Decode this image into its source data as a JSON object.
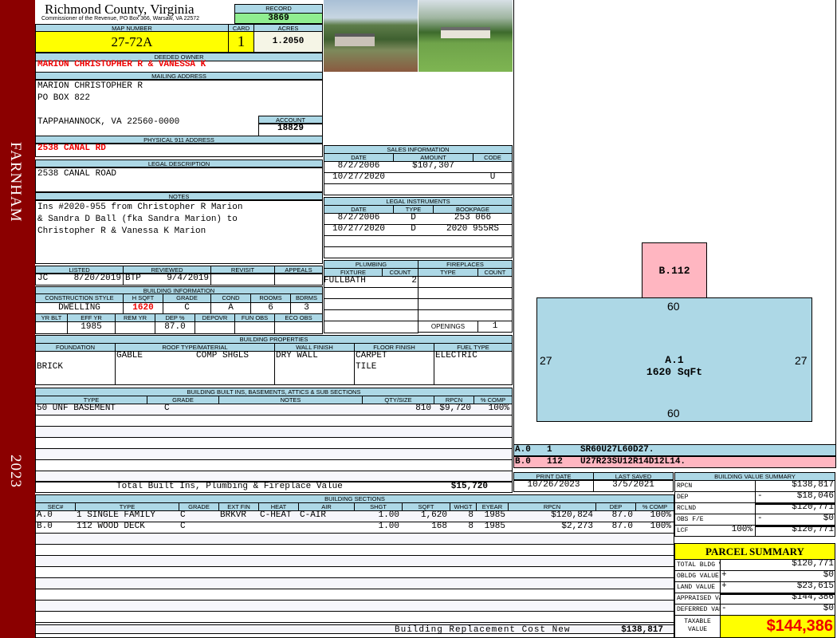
{
  "district": "FARNHAM",
  "year": "2023",
  "header": {
    "county": "Richmond County, Virginia",
    "subtitle": "Commissioner of the Revenue, PO Box 366, Warsaw, VA 22572",
    "record_label": "RECORD",
    "record": "3869"
  },
  "parcel": {
    "map_label": "MAP NUMBER",
    "map": "27-72A",
    "card_label": "CARD",
    "card": "1",
    "acres_label": "ACRES",
    "acres": "1.2050"
  },
  "owner": {
    "label": "DEEDED OWNER",
    "value": "MARION CHRISTOPHER R & VANESSA K"
  },
  "mailing": {
    "label": "MAILING ADDRESS",
    "line1": "MARION CHRISTOPHER R",
    "line2": "PO BOX 822",
    "line3": "TAPPAHANNOCK, VA 22560-0000",
    "account_label": "ACCOUNT",
    "account": "18829"
  },
  "physical": {
    "label": "PHYSICAL 911 ADDRESS",
    "value": "2538 CANAL RD"
  },
  "legal": {
    "label": "LEGAL DESCRIPTION",
    "value": "2538 CANAL ROAD"
  },
  "notes": {
    "label": "NOTES",
    "lines": [
      "Ins #2020-955 from Christopher R Marion",
      "& Sandra D Ball (fka Sandra Marion) to",
      "Christopher R & Vanessa K Marion"
    ]
  },
  "review": {
    "headers": [
      "LISTED",
      "REVIEWED",
      "REVISIT",
      "APPEALS"
    ],
    "listed_by": "JC",
    "listed": "8/20/2019",
    "reviewed_by": "BTP",
    "reviewed": "9/4/2019"
  },
  "building_info": {
    "label": "BUILDING INFORMATION",
    "headers1": [
      "CONSTRUCTION STYLE",
      "H SQFT",
      "GRADE",
      "COND",
      "ROOMS",
      "BDRMS"
    ],
    "values1": [
      "DWELLING",
      "1620",
      "C",
      "A",
      "6",
      "3"
    ],
    "headers2": [
      "YR BLT",
      "EFF YR",
      "REM YR",
      "DEP %",
      "DEPOVR",
      "FUN OBS",
      "ECO OBS"
    ],
    "values2": [
      "",
      "1985",
      "",
      "87.0",
      "",
      "",
      ""
    ]
  },
  "sales": {
    "label": "SALES INFORMATION",
    "headers": [
      "DATE",
      "AMOUNT",
      "CODE"
    ],
    "rows": [
      [
        "8/2/2006",
        "$107,307",
        ""
      ],
      [
        "10/27/2020",
        "",
        "U"
      ],
      [
        "",
        "",
        ""
      ]
    ]
  },
  "instruments": {
    "label": "LEGAL INSTRUMENTS",
    "headers": [
      "DATE",
      "TYPE",
      "BOOKPAGE"
    ],
    "rows": [
      [
        "8/2/2006",
        "D",
        "253 066"
      ],
      [
        "10/27/2020",
        "D",
        "2020 955RS"
      ],
      [
        "",
        "",
        ""
      ],
      [
        "",
        "",
        ""
      ]
    ]
  },
  "plumbing": {
    "label": "PLUMBING",
    "headers": [
      "FIXTURE",
      "COUNT"
    ],
    "rows": [
      [
        "FULLBATH",
        "2"
      ]
    ]
  },
  "fireplaces": {
    "label": "FIREPLACES",
    "headers": [
      "TYPE",
      "COUNT"
    ],
    "openings_label": "OPENINGS",
    "openings": "1"
  },
  "properties": {
    "label": "BUILDING PROPERTIES",
    "headers": [
      "FOUNDATION",
      "ROOF TYPE/MATERIAL",
      "WALL FINISH",
      "FLOOR FINISH",
      "FUEL TYPE"
    ],
    "foundation": "BRICK",
    "roof_type": "GABLE",
    "roof_material": "COMP SHGLS",
    "wall": "DRY WALL",
    "floor1": "CARPET",
    "floor2": "TILE",
    "fuel": "ELECTRIC"
  },
  "builtins": {
    "label": "BUILDING BUILT INS, BASEMENTS, ATTICS & SUB SECTIONS",
    "headers": [
      "TYPE",
      "GRADE",
      "NOTES",
      "QTY/SIZE",
      "RPCN",
      "% COMP"
    ],
    "rows": [
      [
        "50 UNF BASEMENT",
        "C",
        "",
        "810",
        "$9,720",
        "100%"
      ]
    ],
    "total_label": "Total Built Ins, Plumbing & Fireplace Value",
    "total": "$15,720"
  },
  "sections": {
    "label": "BUILDING SECTIONS",
    "headers": [
      "SEC#",
      "TYPE",
      "GRADE",
      "EXT FIN",
      "HEAT",
      "AIR",
      "SHGT",
      "SQFT",
      "WHGT",
      "EYEAR",
      "RPCN",
      "DEP",
      "% COMP"
    ],
    "rows": [
      [
        "A.0",
        "1 SINGLE FAMILY",
        "C",
        "BRKVR",
        "C-HEAT",
        "C-AIR",
        "1.00",
        "1,620",
        "8",
        "1985",
        "$120,824",
        "87.0",
        "100%"
      ],
      [
        "B.0",
        "112 WOOD DECK",
        "C",
        "",
        "",
        "",
        "1.00",
        "168",
        "8",
        "1985",
        "$2,273",
        "87.0",
        "100%"
      ]
    ],
    "total_label": "Building Replacement Cost New",
    "total": "$138,817"
  },
  "sketch": {
    "a_label": "A.1",
    "a_area": "1620 SqFt",
    "b_label": "B.112",
    "top": "60",
    "bottom": "60",
    "left": "27",
    "right": "27",
    "legend": [
      [
        "A.0",
        "1",
        "SR60U27L60D27."
      ],
      [
        "B.0",
        "112",
        "U27R23SU12R14D12L14."
      ]
    ],
    "a_color": "#add8e6",
    "b_color": "#ffb6c1"
  },
  "dates": {
    "print_label": "PRINT DATE",
    "print": "10/26/2023",
    "saved_label": "LAST SAVED",
    "saved": "3/5/2021"
  },
  "value_summary": {
    "label": "BUILDING VALUE SUMMARY",
    "rows": [
      [
        "RPCN",
        "",
        "",
        "$138,817"
      ],
      [
        "DEP",
        "",
        "-",
        "$18,046"
      ],
      [
        "RCLND",
        "",
        "",
        "$120,771"
      ],
      [
        "OBS F/E",
        "",
        "-",
        "$0"
      ],
      [
        "LCF",
        "100%",
        "",
        "$120,771"
      ]
    ]
  },
  "parcel_summary": {
    "label": "PARCEL SUMMARY",
    "rows": [
      [
        "TOTAL BLDG VALUE",
        "",
        "$120,771"
      ],
      [
        "OBLDG VALUE",
        "+",
        "$0"
      ],
      [
        "LAND VALUE",
        "+",
        "$23,615"
      ],
      [
        "APPRAISED VALUE",
        "",
        "$144,386"
      ],
      [
        "DEFERRED VALUE",
        "-",
        "$0"
      ]
    ],
    "taxable_label": "TAXABLE VALUE",
    "taxable": "$144,386"
  }
}
